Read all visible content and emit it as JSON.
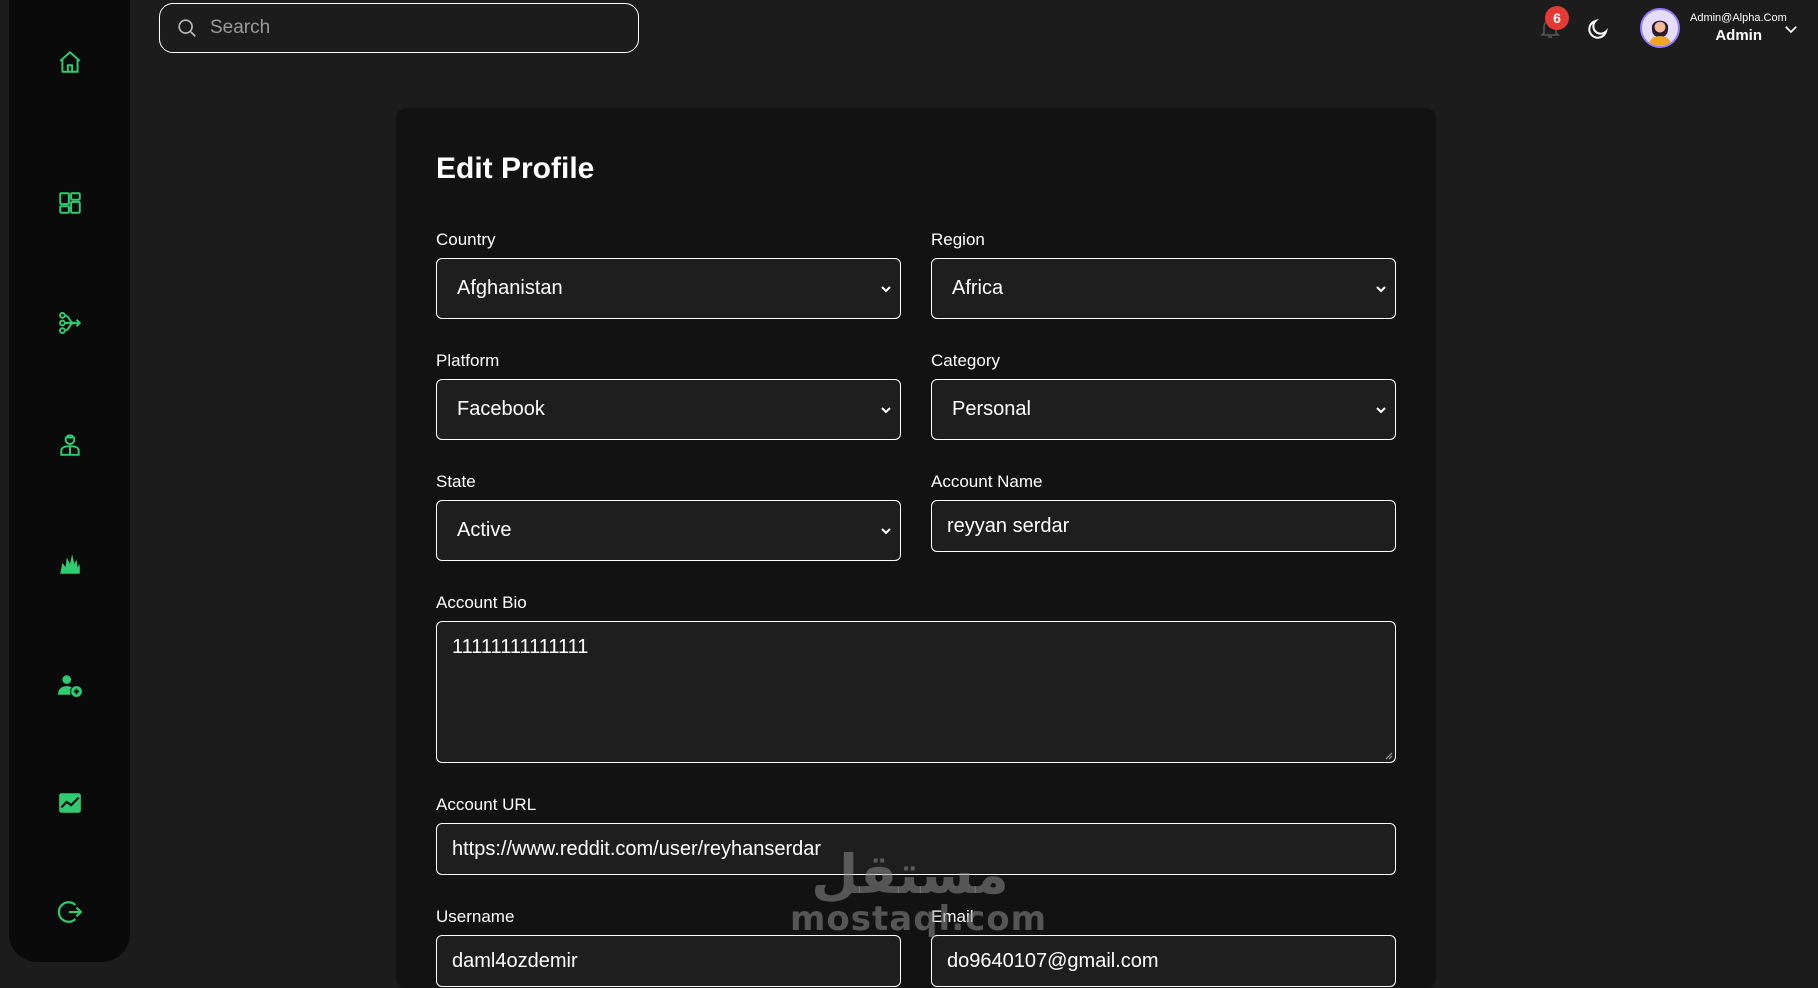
{
  "search": {
    "placeholder": "Search"
  },
  "header": {
    "notification_count": "6",
    "user_email": "Admin@Alpha.Com",
    "user_role": "Admin"
  },
  "sidebar": {
    "items": [
      {
        "icon": "home-icon"
      },
      {
        "icon": "dashboard-icon"
      },
      {
        "icon": "flow-icon"
      },
      {
        "icon": "agent-icon"
      },
      {
        "icon": "crystal-icon"
      },
      {
        "icon": "add-user-icon"
      },
      {
        "icon": "chart-icon"
      },
      {
        "icon": "logout-icon"
      }
    ]
  },
  "form": {
    "title": "Edit Profile",
    "country": {
      "label": "Country",
      "value": "Afghanistan"
    },
    "region": {
      "label": "Region",
      "value": "Africa"
    },
    "platform": {
      "label": "Platform",
      "value": "Facebook"
    },
    "category": {
      "label": "Category",
      "value": "Personal"
    },
    "state": {
      "label": "State",
      "value": "Active"
    },
    "account_name": {
      "label": "Account Name",
      "value": "reyyan serdar"
    },
    "account_bio": {
      "label": "Account Bio",
      "value": "11111111111111"
    },
    "account_url": {
      "label": "Account URL",
      "value": "https://www.reddit.com/user/reyhanserdar"
    },
    "username": {
      "label": "Username",
      "value": "daml4ozdemir"
    },
    "email": {
      "label": "Email",
      "value": "do9640107@gmail.com"
    }
  },
  "watermark": {
    "arabic": "مستقل",
    "latin": "mostaql.com"
  },
  "colors": {
    "accent": "#2ecc71",
    "badge": "#e53935",
    "card": "#121212",
    "background": "#1c1c1c"
  }
}
